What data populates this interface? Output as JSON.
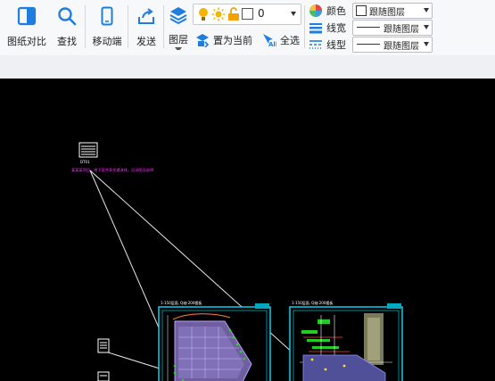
{
  "toolbar": {
    "compare_label": "图纸对比",
    "find_label": "查找",
    "mobile_label": "移动端",
    "send_label": "发送",
    "layer_label": "图层",
    "set_current_label": "置为当前",
    "select_all_label": "全选",
    "layer_dropdown_value": "0",
    "color_label": "颜色",
    "color_value": "跟随图层",
    "linewidth_label": "线宽",
    "linewidth_value": "跟随图层",
    "linetype_label": "线型",
    "linetype_value": "跟随图层"
  },
  "colors": {
    "accent": "#1f7de0",
    "canvas": "#000000",
    "cyan": "#00e5ff",
    "magenta": "#ff33ff"
  },
  "drawing": {
    "sheet_note": "某某某项目，地下室共享交通流线，见详图及说明",
    "sheet1_title": "1-150层面, Q轴-200楼板",
    "sheet2_title": "1-150层面, Q轴-200楼板",
    "block_caption": "DT01"
  }
}
